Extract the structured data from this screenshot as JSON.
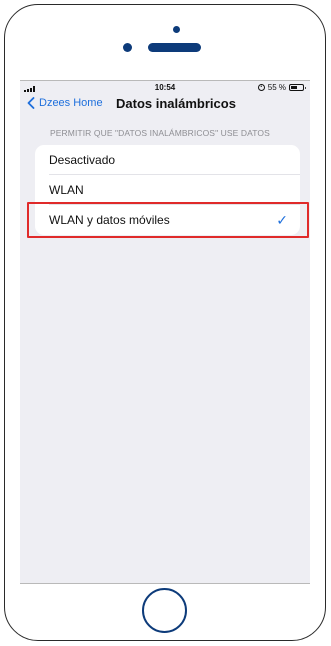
{
  "status": {
    "time": "10:54",
    "battery": "55 %",
    "battery_level": 0.55
  },
  "nav": {
    "back_label": "Dzees Home",
    "title": "Datos inalámbricos"
  },
  "section": {
    "header": "PERMITIR QUE \"DATOS INALÁMBRICOS\" USE DATOS"
  },
  "options": [
    {
      "label": "Desactivado",
      "selected": false
    },
    {
      "label": "WLAN",
      "selected": false
    },
    {
      "label": "WLAN y datos móviles",
      "selected": true
    }
  ],
  "colors": {
    "accent": "#1e6fdc",
    "highlight": "#e02a2a",
    "device": "#0d3b7a"
  },
  "icons": {
    "check": "checkmark-icon",
    "back": "chevron-left-icon"
  }
}
